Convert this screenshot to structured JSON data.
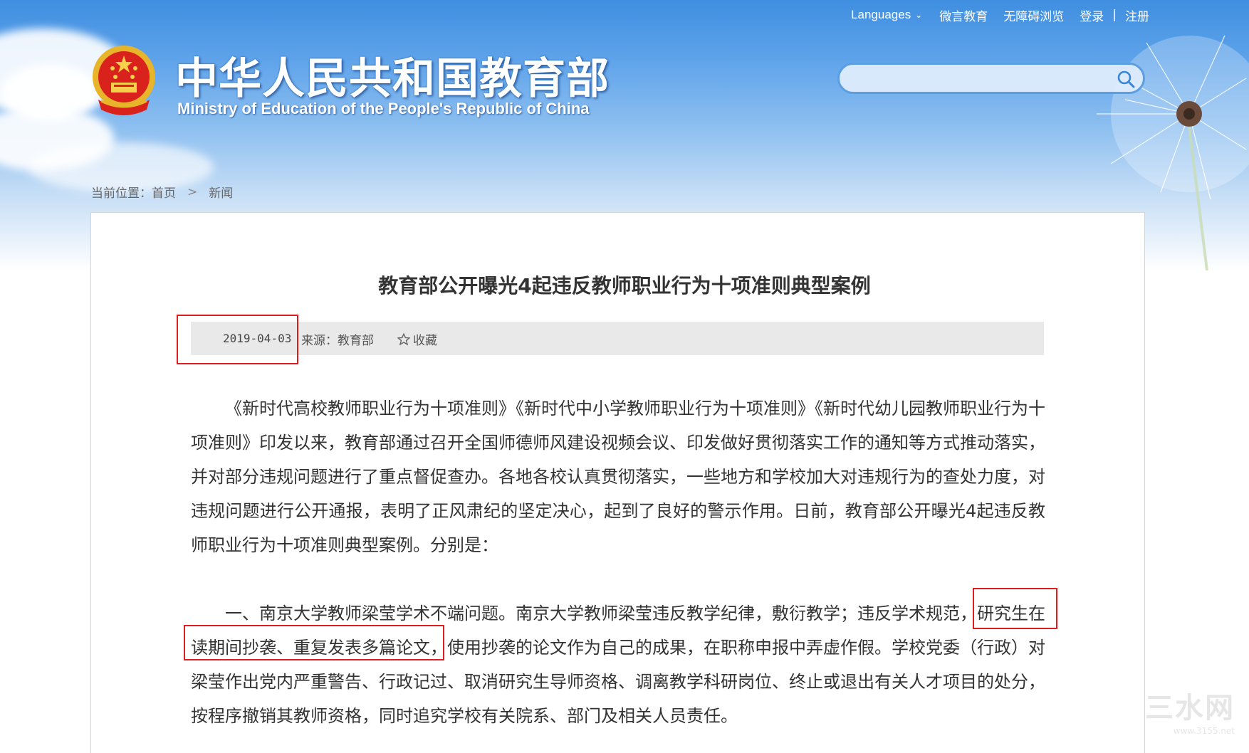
{
  "header": {
    "top_links": {
      "languages": "Languages",
      "weiyan": "微言教育",
      "accessible": "无障碍浏览",
      "login": "登录",
      "separator": "|",
      "register": "注册"
    },
    "site_title_cn": "中华人民共和国教育部",
    "site_title_en": "Ministry of Education of the People's Republic of China",
    "search": {
      "placeholder": ""
    }
  },
  "breadcrumb": {
    "prefix": "当前位置：",
    "home": "首页",
    "arrow": ">",
    "current": "新闻"
  },
  "article": {
    "title": "教育部公开曝光4起违反教师职业行为十项准则典型案例",
    "date": "2019-04-03",
    "source": "来源：教育部",
    "favorite": "收藏",
    "paragraphs": [
      "《新时代高校教师职业行为十项准则》《新时代中小学教师职业行为十项准则》《新时代幼儿园教师职业行为十项准则》印发以来，教育部通过召开全国师德师风建设视频会议、印发做好贯彻落实工作的通知等方式推动落实，并对部分违规问题进行了重点督促查办。各地各校认真贯彻落实，一些地方和学校加大对违规行为的查处力度，对违规问题进行公开通报，表明了正风肃纪的坚定决心，起到了良好的警示作用。日前，教育部公开曝光4起违反教师职业行为十项准则典型案例。分别是：",
      "一、南京大学教师梁莹学术不端问题。南京大学教师梁莹违反教学纪律，敷衍教学；违反学术规范，研究生在读期间抄袭、重复发表多篇论文，使用抄袭的论文作为自己的成果，在职称申报中弄虚作假。学校党委（行政）对梁莹作出党内严重警告、行政记过、取消研究生导师资格、调离教学科研岗位、终止或退出有关人才项目的处分，按程序撤销其教师资格，同时追究学校有关院系、部门及相关人员责任。"
    ]
  },
  "watermark": {
    "main": "三水网",
    "sub": "www.3155.net"
  }
}
